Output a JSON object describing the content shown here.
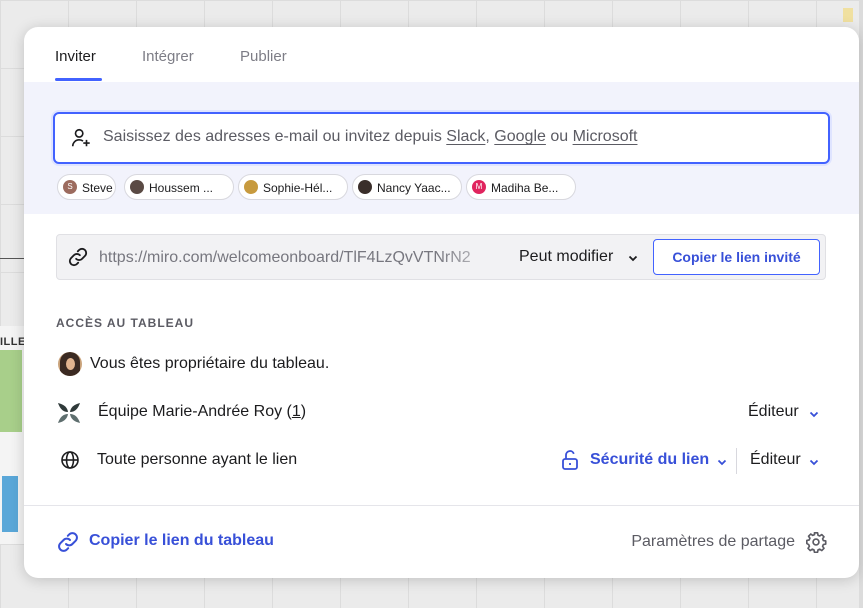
{
  "tabs": [
    {
      "label": "Inviter",
      "active": true
    },
    {
      "label": "Intégrer",
      "active": false
    },
    {
      "label": "Publier",
      "active": false
    }
  ],
  "invite": {
    "placeholder_prefix": "Saisissez des adresses e-mail ou invitez depuis ",
    "slack": "Slack",
    "comma": ", ",
    "google": "Google",
    "ou": " ou ",
    "microsoft": "Microsoft",
    "suggestions": [
      {
        "name": "Steve",
        "initial": "S",
        "color": "#9c6b5e"
      },
      {
        "name": "Houssem ...",
        "initial": "",
        "color": "#5a4a44"
      },
      {
        "name": "Sophie-Hél...",
        "initial": "",
        "color": "#c79a3e"
      },
      {
        "name": "Nancy Yaac...",
        "initial": "",
        "color": "#3a2e2a"
      },
      {
        "name": "Madiha Be...",
        "initial": "M",
        "color": "#e0245e"
      }
    ]
  },
  "link": {
    "url": "https://miro.com/welcomeonboard/TlF4LzQvVTNrN2",
    "permission": "Peut modifier",
    "copy_button": "Copier le lien invité"
  },
  "access": {
    "section_title": "ACCÈS AU TABLEAU",
    "owner_text": "Vous êtes propriétaire du tableau.",
    "team_name": "Équipe Marie-Andrée Roy",
    "team_count": "1",
    "team_role": "Éditeur",
    "anyone_text": "Toute personne ayant le lien",
    "link_security": "Sécurité du lien",
    "anyone_role": "Éditeur"
  },
  "footer": {
    "copy_board_link": "Copier le lien du tableau",
    "share_settings": "Paramètres de partage"
  },
  "colors": {
    "accent": "#4262ff",
    "accent_text": "#3850d8"
  }
}
